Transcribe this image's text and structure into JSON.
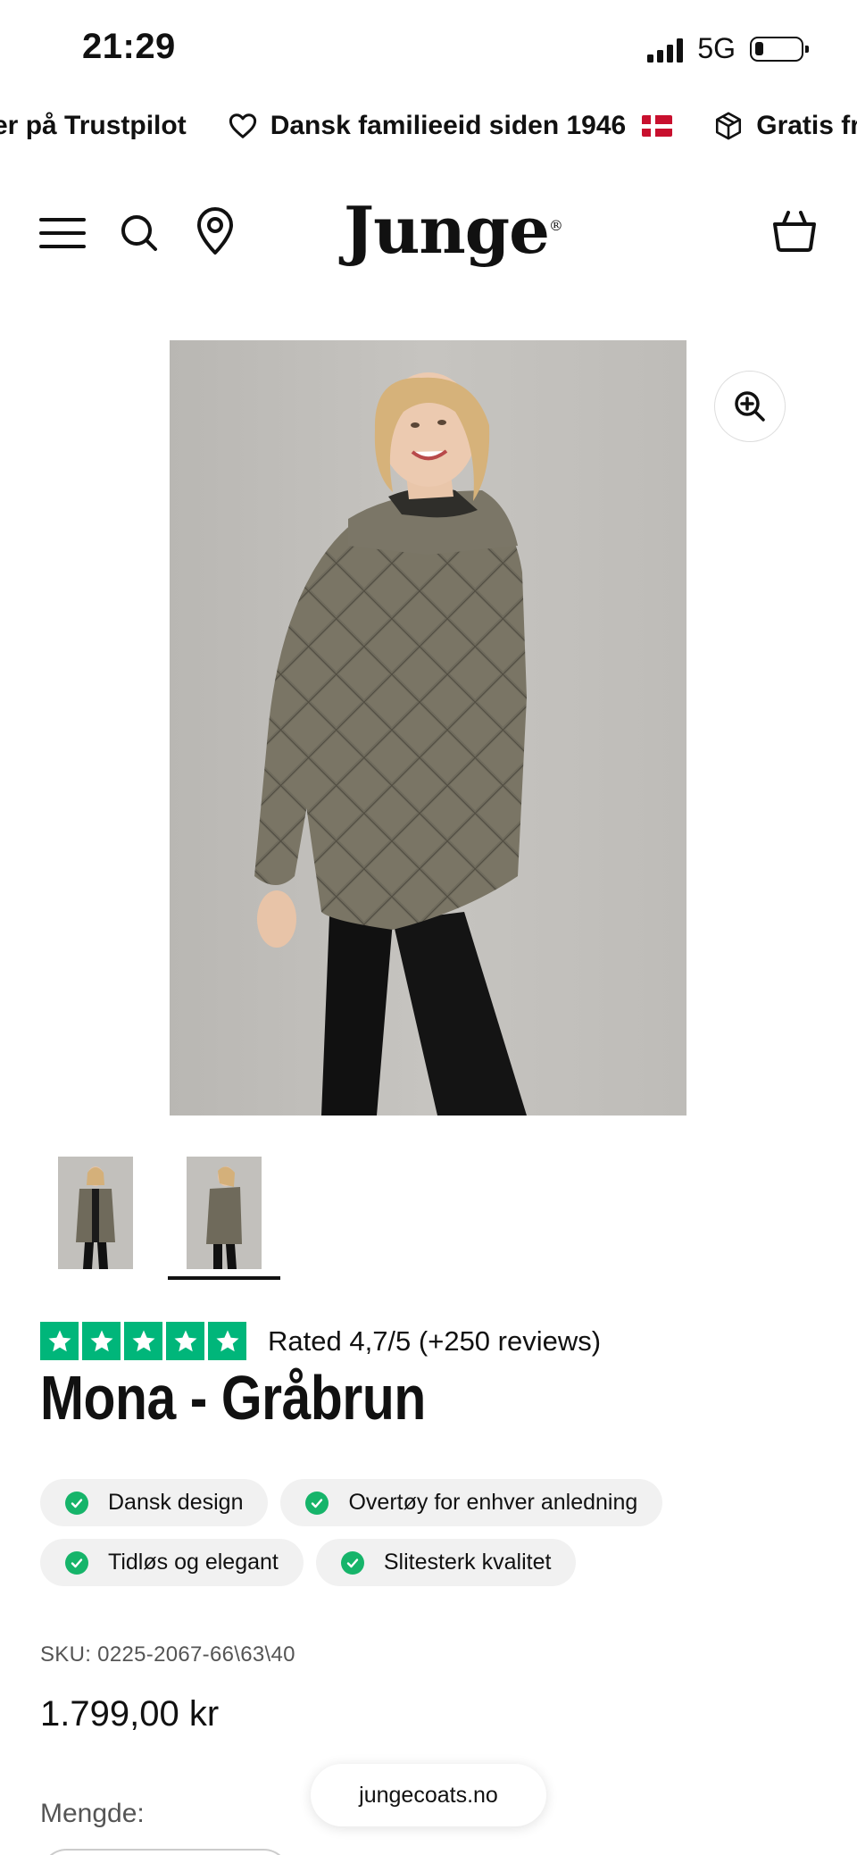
{
  "status_bar": {
    "time": "21:29",
    "network": "5G"
  },
  "marquee": {
    "items": [
      {
        "text": "er på Trustpilot"
      },
      {
        "icon": "heart-icon",
        "text": "Dansk familieeid siden 1946"
      },
      {
        "icon": "package-icon",
        "text": "Gratis fr"
      }
    ]
  },
  "header": {
    "logo": "Junge",
    "logo_mark": "®"
  },
  "product": {
    "rating_text": "Rated 4,7/5 (+250 reviews)",
    "rating_stars": 5,
    "title": "Mona - Gråbrun",
    "badges": [
      "Dansk design",
      "Overtøy for enhver anledning",
      "Tidløs og elegant",
      "Slitesterk kvalitet"
    ],
    "sku": "SKU: 0225-2067-66\\63\\40",
    "price": "1.799,00 kr",
    "quantity_label": "Mengde:"
  },
  "browser": {
    "site": "jungecoats.no"
  },
  "colors": {
    "trustpilot_green": "#00b67a",
    "check_green": "#16b46a"
  }
}
